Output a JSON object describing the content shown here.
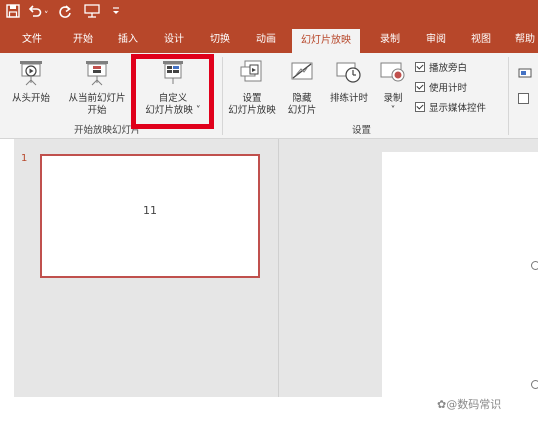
{
  "quick_access": {
    "save_icon": "save-icon",
    "undo_icon": "undo-icon",
    "redo_icon": "redo-icon",
    "customize_icon": "customize-icon"
  },
  "tabs": [
    {
      "label": "文件"
    },
    {
      "label": "开始"
    },
    {
      "label": "插入"
    },
    {
      "label": "设计"
    },
    {
      "label": "切换"
    },
    {
      "label": "动画"
    },
    {
      "label": "幻灯片放映",
      "active": true
    },
    {
      "label": "录制"
    },
    {
      "label": "审阅"
    },
    {
      "label": "视图"
    },
    {
      "label": "帮助"
    }
  ],
  "ribbon": {
    "start_group": {
      "from_beginning": "从头开始",
      "from_current_line1": "从当前幻灯片",
      "from_current_line2": "开始",
      "custom_line1": "自定义",
      "custom_line2": "幻灯片放映 ˅",
      "group_label": "开始放映幻灯片"
    },
    "setup_group": {
      "setup_line1": "设置",
      "setup_line2": "幻灯片放映",
      "hide_line1": "隐藏",
      "hide_line2": "幻灯片",
      "rehearse": "排练计时",
      "record_line1": "录制",
      "record_line2": "˅",
      "play_narration": "播放旁白",
      "use_timings": "使用计时",
      "show_media_controls": "显示媒体控件",
      "group_label": "设置"
    }
  },
  "slides": [
    {
      "number": "1",
      "text": "11"
    }
  ],
  "watermark": "@数码常识",
  "colors": {
    "accent": "#b7472a",
    "highlight": "#e0001b"
  }
}
